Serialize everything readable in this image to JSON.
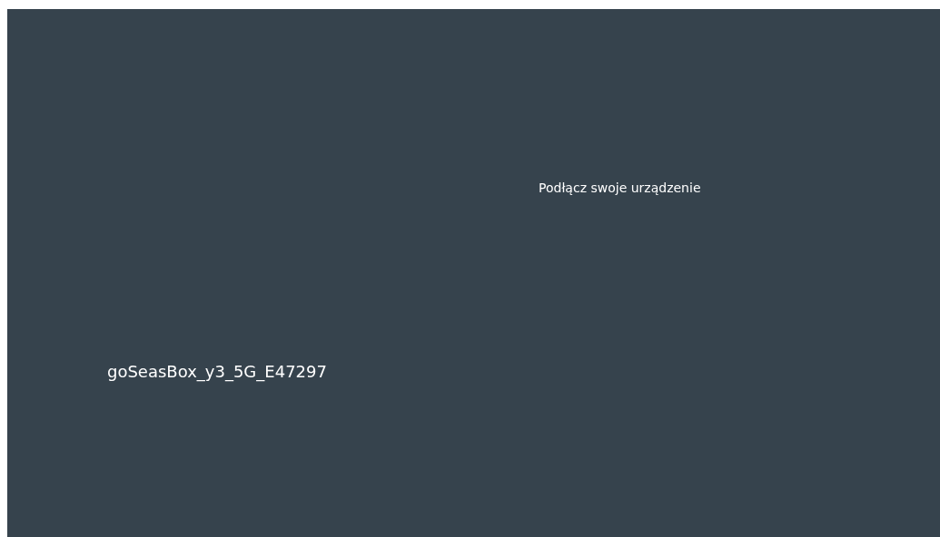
{
  "header": {
    "title": "Podłącz swoje urządzenie"
  },
  "device": {
    "name": "goSeasBox_y3_5G_E47297"
  }
}
